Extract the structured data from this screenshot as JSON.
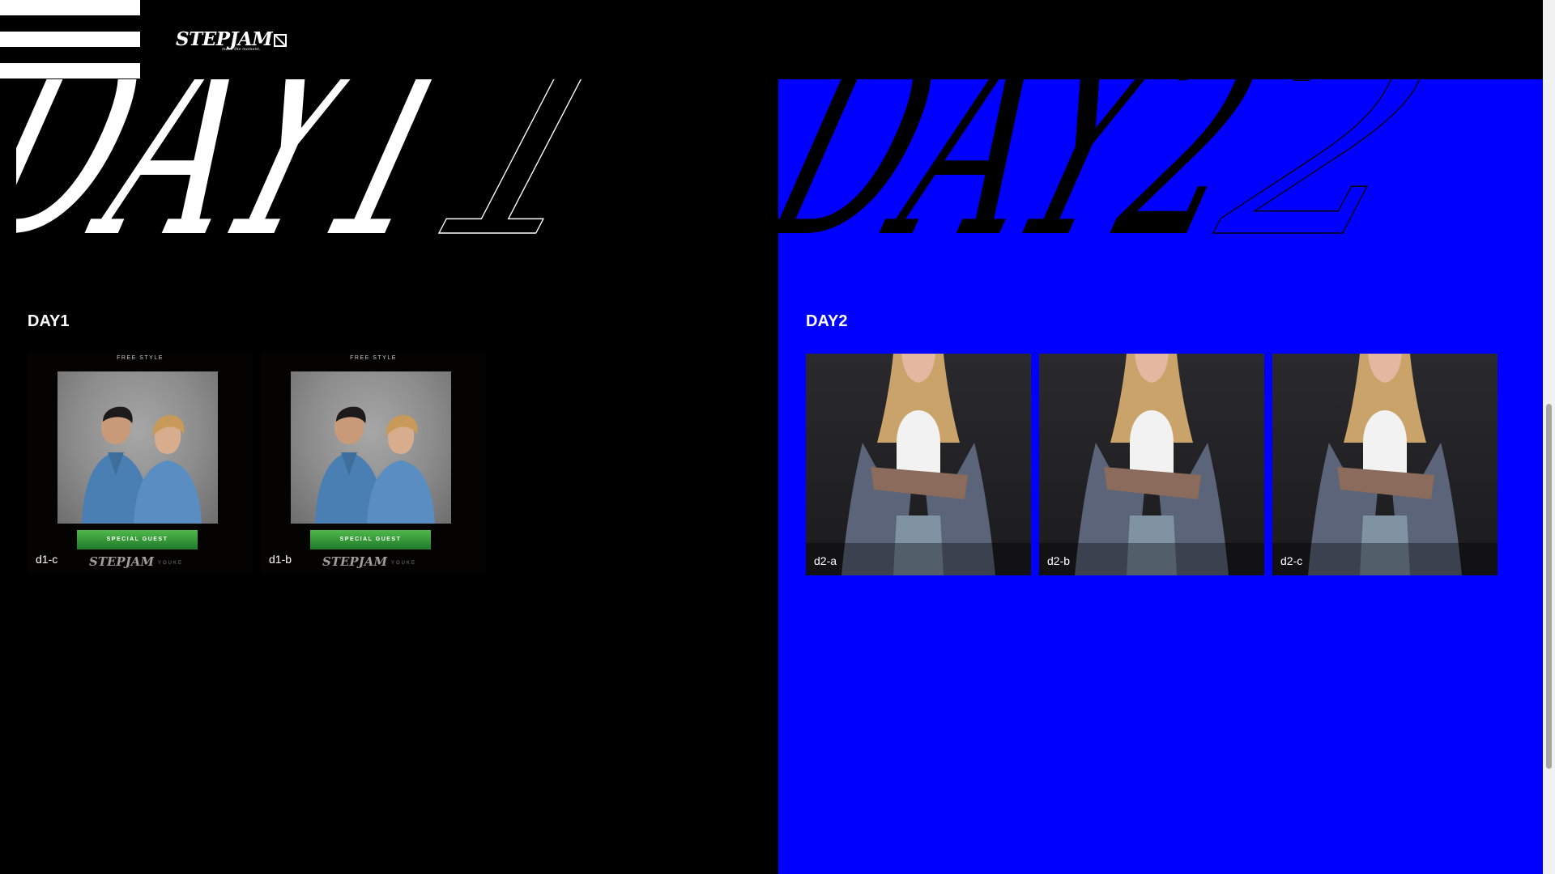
{
  "header": {
    "logo_text": "STEPJAM",
    "logo_sub": "make the moment.",
    "menu_icon": "hamburger-menu-icon"
  },
  "hero": {
    "day1_title": "DAY1",
    "day2_title": "DAY2"
  },
  "sections": {
    "day1": {
      "label": "DAY1",
      "bg_color": "#000000",
      "cards": [
        {
          "name": "d1-c",
          "poster_top": "FREE STYLE",
          "poster_band": "SPECIAL GUEST",
          "poster_logo": "STEPJAM",
          "poster_sub": "YOUKE"
        },
        {
          "name": "d1-b",
          "poster_top": "FREE STYLE",
          "poster_band": "SPECIAL GUEST",
          "poster_logo": "STEPJAM",
          "poster_sub": "YOUKE"
        }
      ]
    },
    "day2": {
      "label": "DAY2",
      "bg_color": "#0000ff",
      "cards": [
        {
          "name": "d2-a"
        },
        {
          "name": "d2-b"
        },
        {
          "name": "d2-c"
        }
      ]
    }
  }
}
